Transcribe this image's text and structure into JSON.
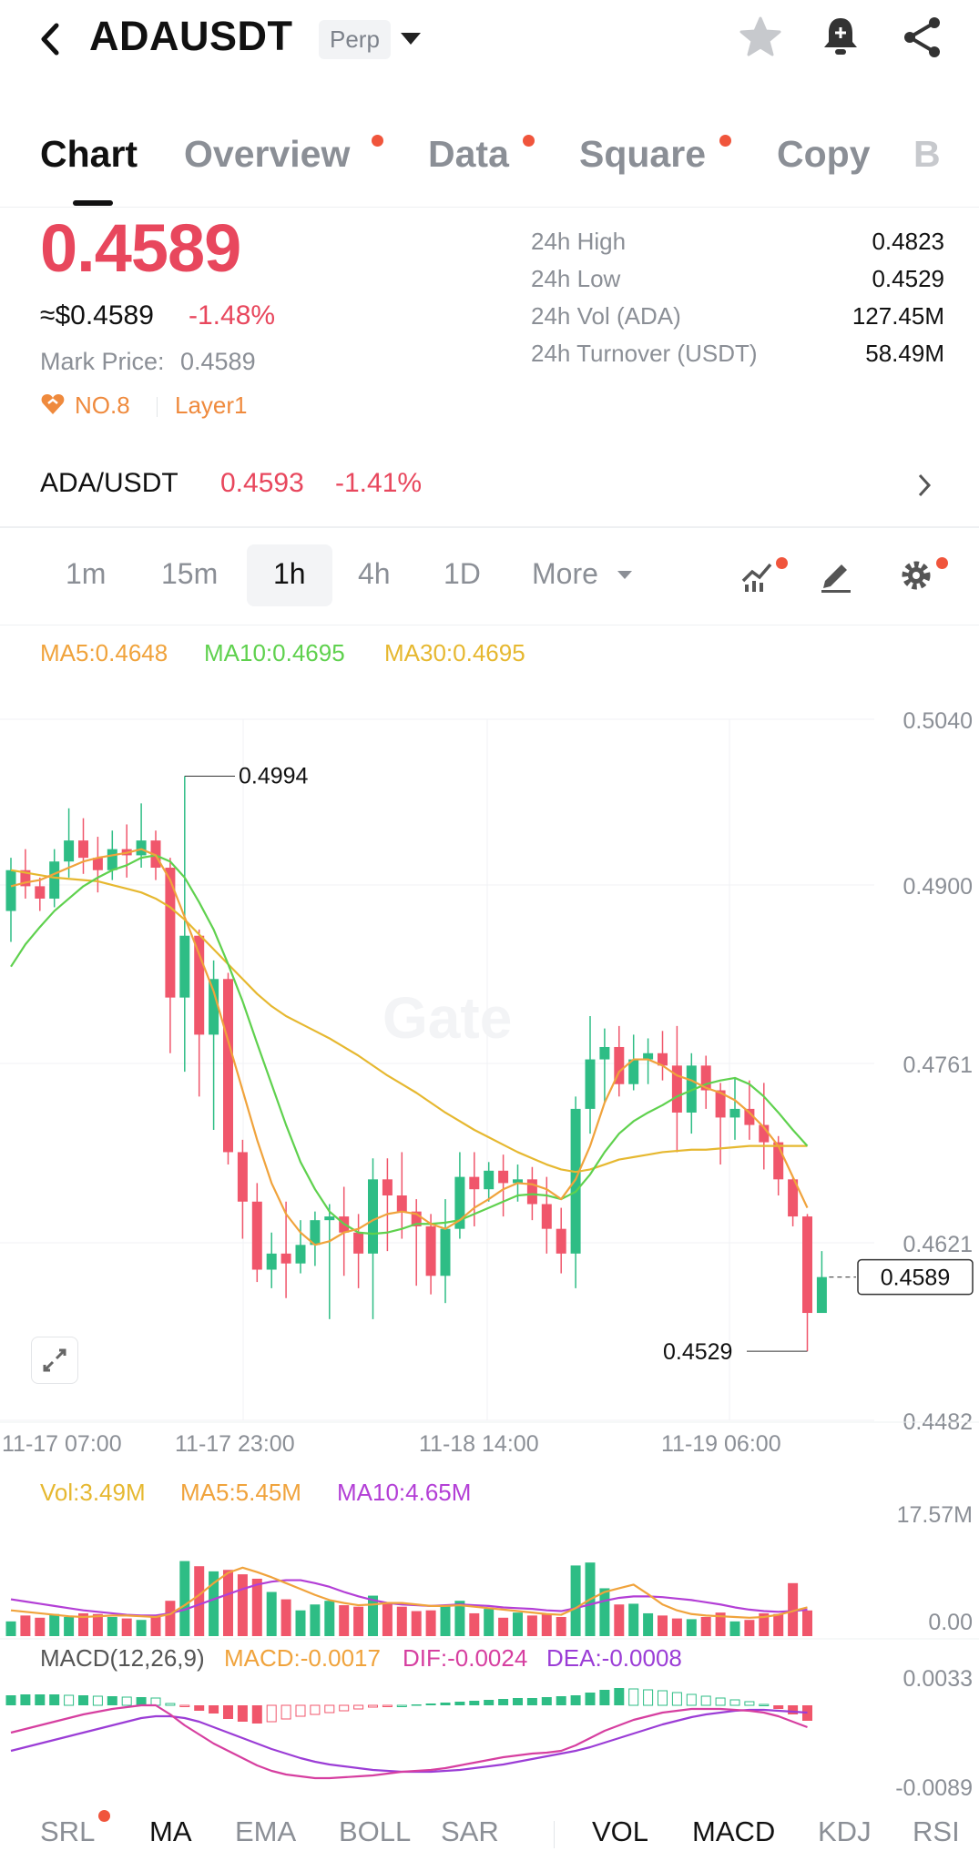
{
  "header": {
    "symbol": "ADAUSDT",
    "contract_type": "Perp"
  },
  "tabs": [
    {
      "label": "Chart",
      "active": true,
      "dot": false
    },
    {
      "label": "Overview",
      "active": false,
      "dot": true
    },
    {
      "label": "Data",
      "active": false,
      "dot": true
    },
    {
      "label": "Square",
      "active": false,
      "dot": true
    },
    {
      "label": "Copy",
      "active": false,
      "dot": false
    },
    {
      "label": "B",
      "active": false,
      "dot": false
    }
  ],
  "price": {
    "last": "0.4589",
    "usd": "≈$0.4589",
    "change": "-1.48%",
    "mark_label": "Mark Price:",
    "mark_value": "0.4589",
    "rank": "NO.8",
    "category": "Layer1"
  },
  "stats": {
    "high_label": "24h High",
    "high": "0.4823",
    "low_label": "24h Low",
    "low": "0.4529",
    "vol_label": "24h Vol (ADA)",
    "vol": "127.45M",
    "turnover_label": "24h Turnover (USDT)",
    "turnover": "58.49M"
  },
  "spot": {
    "pair": "ADA/USDT",
    "price": "0.4593",
    "change": "-1.41%"
  },
  "intervals": {
    "items": [
      "1m",
      "15m",
      "1h",
      "4h",
      "1D"
    ],
    "selected": "1h",
    "more": "More"
  },
  "ma_legend": {
    "ma5": "MA5:0.4648",
    "ma10": "MA10:0.4695",
    "ma30": "MA30:0.4695"
  },
  "vol_legend": {
    "vol": "Vol:3.49M",
    "ma5": "MA5:5.45M",
    "ma10": "MA10:4.65M"
  },
  "macd_legend": {
    "name": "MACD(12,26,9)",
    "macd": "MACD:-0.0017",
    "dif": "DIF:-0.0024",
    "dea": "DEA:-0.0008"
  },
  "bottom_indicators": [
    "SRL",
    "MA",
    "EMA",
    "BOLL",
    "SAR",
    "VOL",
    "MACD",
    "KDJ",
    "RSI"
  ],
  "colors": {
    "up": "#2ebd85",
    "down": "#f0566b",
    "ma5": "#f0a33c",
    "ma10": "#5fd14e",
    "ma30": "#e6b830",
    "macd_dif": "#d63fa0",
    "macd_dea": "#9b3dd6",
    "vol_ma10": "#b33fd6"
  },
  "chart_data": {
    "type": "candlestick",
    "y_ticks": [
      "0.5040",
      "0.4900",
      "0.4761",
      "0.4621",
      "0.4482"
    ],
    "ylim": [
      0.4482,
      0.504
    ],
    "x_ticks": [
      "11-17 07:00",
      "11-17 23:00",
      "11-18 14:00",
      "11-19 06:00"
    ],
    "high_annotation": "0.4994",
    "low_annotation": "0.4529",
    "current_price_tag": "0.4589",
    "candles": [
      [
        0.4885,
        0.4918,
        0.486,
        0.4928
      ],
      [
        0.4918,
        0.4905,
        0.4895,
        0.4935
      ],
      [
        0.4905,
        0.4895,
        0.4885,
        0.4912
      ],
      [
        0.4895,
        0.4925,
        0.4888,
        0.4935
      ],
      [
        0.4925,
        0.4942,
        0.4912,
        0.4968
      ],
      [
        0.4942,
        0.4928,
        0.4915,
        0.496
      ],
      [
        0.4928,
        0.4918,
        0.49,
        0.4945
      ],
      [
        0.4918,
        0.4935,
        0.491,
        0.495
      ],
      [
        0.4935,
        0.493,
        0.4912,
        0.4955
      ],
      [
        0.493,
        0.4942,
        0.492,
        0.4972
      ],
      [
        0.4942,
        0.492,
        0.491,
        0.495
      ],
      [
        0.492,
        0.4815,
        0.477,
        0.4928
      ],
      [
        0.4815,
        0.4865,
        0.4755,
        0.4994
      ],
      [
        0.4865,
        0.4785,
        0.4735,
        0.487
      ],
      [
        0.4785,
        0.483,
        0.4708,
        0.4845
      ],
      [
        0.483,
        0.469,
        0.468,
        0.4835
      ],
      [
        0.469,
        0.465,
        0.462,
        0.47
      ],
      [
        0.465,
        0.4595,
        0.4585,
        0.4665
      ],
      [
        0.4595,
        0.4608,
        0.458,
        0.4625
      ],
      [
        0.4608,
        0.46,
        0.4572,
        0.465
      ],
      [
        0.46,
        0.4615,
        0.4592,
        0.4635
      ],
      [
        0.4615,
        0.4635,
        0.4598,
        0.4642
      ],
      [
        0.4635,
        0.4638,
        0.4555,
        0.4648
      ],
      [
        0.4638,
        0.4625,
        0.459,
        0.4662
      ],
      [
        0.4625,
        0.4608,
        0.458,
        0.464
      ],
      [
        0.4608,
        0.4668,
        0.4555,
        0.4685
      ],
      [
        0.4668,
        0.4655,
        0.461,
        0.4685
      ],
      [
        0.4655,
        0.4642,
        0.462,
        0.469
      ],
      [
        0.4642,
        0.463,
        0.4582,
        0.4652
      ],
      [
        0.463,
        0.459,
        0.4575,
        0.464
      ],
      [
        0.459,
        0.4628,
        0.4568,
        0.4652
      ],
      [
        0.4628,
        0.467,
        0.462,
        0.469
      ],
      [
        0.467,
        0.466,
        0.463,
        0.469
      ],
      [
        0.466,
        0.4675,
        0.465,
        0.4682
      ],
      [
        0.4675,
        0.4665,
        0.4638,
        0.4688
      ],
      [
        0.4665,
        0.4668,
        0.465,
        0.468
      ],
      [
        0.4668,
        0.4648,
        0.4635,
        0.4678
      ],
      [
        0.4648,
        0.4628,
        0.4608,
        0.467
      ],
      [
        0.4628,
        0.4608,
        0.4592,
        0.4645
      ],
      [
        0.4608,
        0.4725,
        0.458,
        0.4735
      ],
      [
        0.4725,
        0.4765,
        0.4705,
        0.48
      ],
      [
        0.4765,
        0.4775,
        0.473,
        0.479
      ],
      [
        0.4775,
        0.4745,
        0.4735,
        0.4792
      ],
      [
        0.4745,
        0.4765,
        0.474,
        0.4785
      ],
      [
        0.4765,
        0.477,
        0.4745,
        0.4782
      ],
      [
        0.477,
        0.476,
        0.4748,
        0.4788
      ],
      [
        0.476,
        0.4722,
        0.469,
        0.4792
      ],
      [
        0.4722,
        0.476,
        0.4705,
        0.477
      ],
      [
        0.476,
        0.474,
        0.4725,
        0.4768
      ],
      [
        0.474,
        0.4718,
        0.468,
        0.4746
      ],
      [
        0.4718,
        0.4725,
        0.47,
        0.475
      ],
      [
        0.4725,
        0.4712,
        0.47,
        0.4748
      ],
      [
        0.4712,
        0.4698,
        0.4676,
        0.4746
      ],
      [
        0.4698,
        0.4668,
        0.4655,
        0.4703
      ],
      [
        0.4668,
        0.4638,
        0.463,
        0.467
      ],
      [
        0.4638,
        0.456,
        0.4529,
        0.464
      ],
      [
        0.456,
        0.4589,
        0.4565,
        0.461
      ]
    ],
    "ma5": [
      0.4905,
      0.4908,
      0.491,
      0.4915,
      0.492,
      0.4925,
      0.4928,
      0.493,
      0.4932,
      0.4935,
      0.493,
      0.491,
      0.488,
      0.485,
      0.482,
      0.478,
      0.474,
      0.47,
      0.4665,
      0.464,
      0.4625,
      0.4615,
      0.4618,
      0.4625,
      0.4628,
      0.4635,
      0.464,
      0.4642,
      0.464,
      0.4632,
      0.4628,
      0.4635,
      0.4645,
      0.4652,
      0.466,
      0.4665,
      0.4664,
      0.466,
      0.4652,
      0.4668,
      0.4695,
      0.473,
      0.4755,
      0.4765,
      0.4765,
      0.476,
      0.4752,
      0.4748,
      0.4742,
      0.4738,
      0.4732,
      0.4722,
      0.471,
      0.4695,
      0.467,
      0.4645
    ],
    "ma10": [
      0.484,
      0.4858,
      0.4872,
      0.4885,
      0.4895,
      0.4905,
      0.4912,
      0.4918,
      0.4922,
      0.4928,
      0.493,
      0.4925,
      0.4912,
      0.4892,
      0.487,
      0.4842,
      0.4812,
      0.4778,
      0.4745,
      0.4712,
      0.4682,
      0.466,
      0.4642,
      0.4632,
      0.4625,
      0.4624,
      0.4625,
      0.4628,
      0.4632,
      0.4632,
      0.4633,
      0.4635,
      0.464,
      0.4645,
      0.465,
      0.4655,
      0.4656,
      0.4655,
      0.4652,
      0.4658,
      0.4672,
      0.469,
      0.4705,
      0.4715,
      0.4722,
      0.4728,
      0.4735,
      0.474,
      0.4745,
      0.4748,
      0.475,
      0.4745,
      0.4735,
      0.4722,
      0.4708,
      0.4695
    ],
    "ma30": [
      0.4918,
      0.4916,
      0.4914,
      0.4912,
      0.4911,
      0.491,
      0.4909,
      0.4906,
      0.4903,
      0.49,
      0.4895,
      0.4888,
      0.4878,
      0.4866,
      0.4854,
      0.4842,
      0.483,
      0.4818,
      0.4808,
      0.48,
      0.4794,
      0.4788,
      0.4782,
      0.4775,
      0.4768,
      0.476,
      0.4752,
      0.4745,
      0.4738,
      0.473,
      0.4722,
      0.4715,
      0.4708,
      0.4702,
      0.4696,
      0.469,
      0.4685,
      0.468,
      0.4676,
      0.4674,
      0.4676,
      0.468,
      0.4684,
      0.4686,
      0.4688,
      0.469,
      0.4691,
      0.4692,
      0.4692,
      0.4693,
      0.4694,
      0.4695,
      0.4695,
      0.4695,
      0.4695,
      0.4695
    ],
    "volume_ylim": [
      "0.00",
      "17.57M"
    ],
    "volumes": [
      2.0,
      2.8,
      2.5,
      3.0,
      2.6,
      3.1,
      3.0,
      2.6,
      2.4,
      2.2,
      2.8,
      4.8,
      10.2,
      9.5,
      8.8,
      9.0,
      8.4,
      7.8,
      6.0,
      5.0,
      3.5,
      4.3,
      4.8,
      4.2,
      4.0,
      5.5,
      4.5,
      4.0,
      3.4,
      3.5,
      4.1,
      4.8,
      3.1,
      3.7,
      2.5,
      3.2,
      2.8,
      3.0,
      2.6,
      9.6,
      10.0,
      6.5,
      4.3,
      4.4,
      3.1,
      2.8,
      2.4,
      2.3,
      2.6,
      3.2,
      2.0,
      2.2,
      3.1,
      3.0,
      7.2,
      3.49
    ],
    "vol_ma5": [
      3.5,
      3.3,
      3.1,
      2.9,
      2.7,
      2.6,
      2.7,
      2.8,
      2.8,
      2.7,
      2.6,
      3.0,
      4.2,
      5.6,
      7.2,
      8.6,
      9.3,
      8.7,
      8.0,
      7.2,
      6.4,
      5.6,
      4.9,
      4.5,
      4.2,
      4.3,
      4.5,
      4.5,
      4.3,
      4.1,
      4.1,
      4.2,
      4.0,
      3.8,
      3.6,
      3.4,
      3.2,
      3.0,
      2.9,
      3.8,
      5.0,
      6.0,
      6.5,
      7.0,
      5.7,
      4.3,
      3.5,
      3.0,
      2.8,
      2.7,
      2.6,
      2.5,
      2.6,
      2.9,
      3.4,
      3.9
    ],
    "vol_ma10": [
      5.0,
      4.7,
      4.4,
      4.1,
      3.8,
      3.5,
      3.3,
      3.1,
      2.9,
      2.8,
      2.8,
      3.1,
      3.6,
      4.3,
      5.0,
      5.7,
      6.4,
      7.0,
      7.4,
      7.6,
      7.6,
      7.2,
      6.7,
      6.0,
      5.4,
      4.9,
      4.5,
      4.3,
      4.2,
      4.1,
      4.2,
      4.3,
      4.2,
      4.1,
      3.9,
      3.8,
      3.7,
      3.5,
      3.4,
      3.8,
      4.3,
      4.8,
      5.2,
      5.4,
      5.4,
      5.3,
      5.1,
      4.9,
      4.6,
      4.3,
      3.9,
      3.6,
      3.4,
      3.3,
      3.4,
      3.6
    ],
    "macd_ylim": [
      "-0.0089",
      "0.0033"
    ],
    "macd_hist": [
      0.0011,
      0.0012,
      0.0012,
      0.0012,
      0.0011,
      0.0011,
      0.001,
      0.001,
      0.0009,
      0.0009,
      0.0008,
      0.0002,
      -0.0001,
      -0.0006,
      -0.0009,
      -0.0015,
      -0.0018,
      -0.002,
      -0.0018,
      -0.0015,
      -0.0012,
      -0.001,
      -0.0008,
      -0.0006,
      -0.0004,
      -0.0002,
      -0.0001,
      0.0,
      0.0001,
      0.0002,
      0.0003,
      0.0004,
      0.0005,
      0.0006,
      0.0007,
      0.0008,
      0.0008,
      0.0009,
      0.001,
      0.0011,
      0.0014,
      0.0017,
      0.0019,
      0.0018,
      0.0017,
      0.0016,
      0.0014,
      0.0012,
      0.001,
      0.0008,
      0.0006,
      0.0004,
      0.0001,
      -0.0004,
      -0.001,
      -0.0017
    ],
    "dif": [
      -0.003,
      -0.0026,
      -0.0022,
      -0.0018,
      -0.0014,
      -0.001,
      -0.0007,
      -0.0004,
      -0.0002,
      0.0,
      0.0,
      -0.001,
      -0.0022,
      -0.0032,
      -0.0042,
      -0.005,
      -0.0058,
      -0.0066,
      -0.0072,
      -0.0076,
      -0.0078,
      -0.008,
      -0.008,
      -0.0079,
      -0.0078,
      -0.0077,
      -0.0075,
      -0.0073,
      -0.0072,
      -0.0071,
      -0.0069,
      -0.0066,
      -0.0063,
      -0.006,
      -0.0057,
      -0.0055,
      -0.0053,
      -0.0052,
      -0.005,
      -0.0044,
      -0.0036,
      -0.0028,
      -0.0022,
      -0.0016,
      -0.0012,
      -0.0008,
      -0.0006,
      -0.0004,
      -0.0004,
      -0.0004,
      -0.0005,
      -0.0006,
      -0.0008,
      -0.0012,
      -0.0018,
      -0.0024
    ],
    "dea": [
      -0.005,
      -0.0046,
      -0.0042,
      -0.0038,
      -0.0034,
      -0.003,
      -0.0026,
      -0.0022,
      -0.0018,
      -0.0014,
      -0.0012,
      -0.0012,
      -0.0014,
      -0.0018,
      -0.0024,
      -0.003,
      -0.0036,
      -0.0042,
      -0.0048,
      -0.0053,
      -0.0058,
      -0.0062,
      -0.0065,
      -0.0067,
      -0.0069,
      -0.0071,
      -0.0072,
      -0.0073,
      -0.0073,
      -0.0073,
      -0.0072,
      -0.0071,
      -0.0069,
      -0.0067,
      -0.0065,
      -0.0062,
      -0.0059,
      -0.0056,
      -0.0053,
      -0.005,
      -0.0046,
      -0.0041,
      -0.0036,
      -0.0031,
      -0.0026,
      -0.0021,
      -0.0017,
      -0.0013,
      -0.001,
      -0.0008,
      -0.0006,
      -0.0005,
      -0.0005,
      -0.0006,
      -0.0007,
      -0.0008
    ]
  }
}
